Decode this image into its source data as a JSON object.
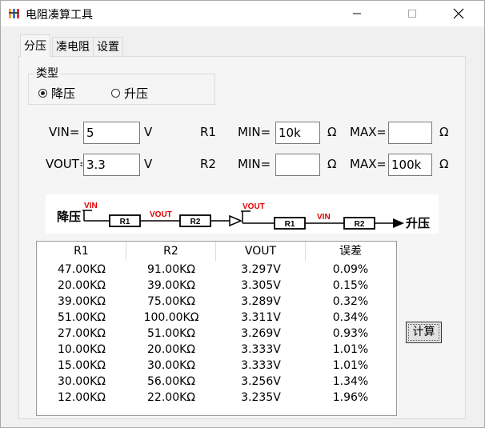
{
  "window": {
    "title": "电阻凑算工具",
    "controls": [
      "minimize-icon",
      "maximize-icon",
      "close-icon"
    ]
  },
  "tabs": [
    {
      "label": "分压",
      "active": true
    },
    {
      "label": "凑电阻",
      "active": false
    },
    {
      "label": "设置",
      "active": false
    }
  ],
  "type_group": {
    "label": "类型",
    "options": [
      {
        "label": "降压",
        "selected": true
      },
      {
        "label": "升压",
        "selected": false
      }
    ]
  },
  "form": {
    "vin_label": "VIN=",
    "vin_value": "5",
    "vin_unit": "V",
    "vout_label": "VOUT=",
    "vout_value": "3.3",
    "vout_unit": "V",
    "r1_label": "R1",
    "r2_label": "R2",
    "min_label": "MIN=",
    "max_label": "MAX=",
    "r1_min": "10k",
    "r1_max": "",
    "r2_min": "",
    "r2_max": "100k",
    "ohm": "Ω"
  },
  "diagram": {
    "left_title": "降压",
    "right_title": "升压",
    "vin": "VIN",
    "vout": "VOUT",
    "r1": "R1",
    "r2": "R2",
    "accent_color": "#e00000"
  },
  "results": {
    "columns": [
      "R1",
      "R2",
      "VOUT",
      "误差"
    ],
    "rows": [
      [
        "47.00KΩ",
        "91.00KΩ",
        "3.297V",
        "0.09%"
      ],
      [
        "20.00KΩ",
        "39.00KΩ",
        "3.305V",
        "0.15%"
      ],
      [
        "39.00KΩ",
        "75.00KΩ",
        "3.289V",
        "0.32%"
      ],
      [
        "51.00KΩ",
        "100.00KΩ",
        "3.311V",
        "0.34%"
      ],
      [
        "27.00KΩ",
        "51.00KΩ",
        "3.269V",
        "0.93%"
      ],
      [
        "10.00KΩ",
        "20.00KΩ",
        "3.333V",
        "1.01%"
      ],
      [
        "15.00KΩ",
        "30.00KΩ",
        "3.333V",
        "1.01%"
      ],
      [
        "30.00KΩ",
        "56.00KΩ",
        "3.256V",
        "1.34%"
      ],
      [
        "12.00KΩ",
        "22.00KΩ",
        "3.235V",
        "1.96%"
      ]
    ]
  },
  "calc_button": "计算"
}
